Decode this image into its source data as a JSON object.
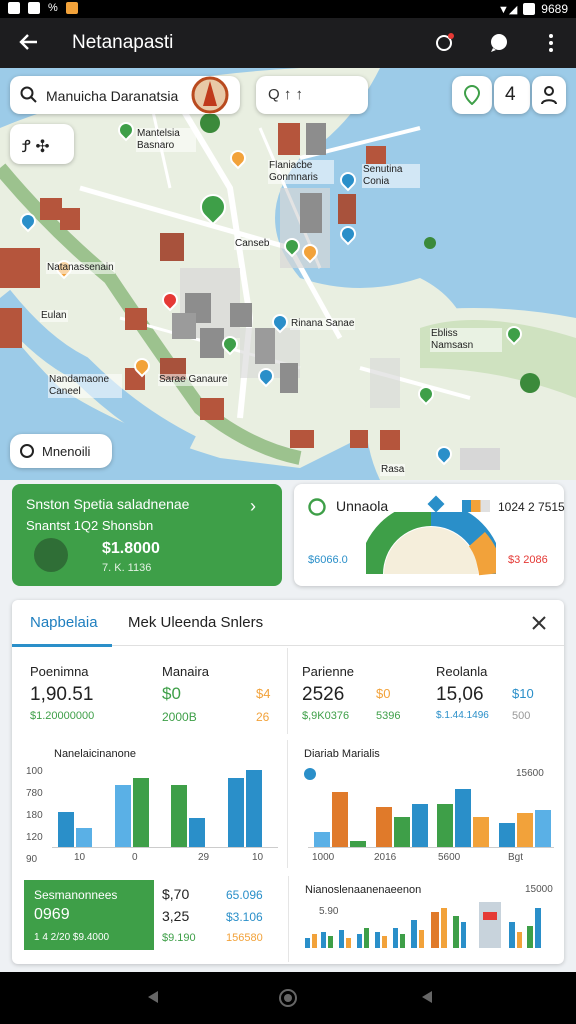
{
  "status": {
    "left_icons": [
      "notification-icon",
      "sim-icon",
      "percent-icon",
      "app-icon"
    ],
    "time": "9689"
  },
  "appbar": {
    "title": "Netanapasti"
  },
  "map": {
    "search_text": "Manuicha Daranatsia",
    "search2_text": "Q ↑ ↑",
    "tool_text": "Ꝭ ✣",
    "zoom_text": "4",
    "labels": [
      "Mantelsia Basnaro",
      "Flaniacbe Gonmnaris",
      "Natanassenain",
      "Eulan",
      "Nandamaone Caneel",
      "Sarae Ganaure",
      "Rinana Sanae",
      "Senutina Conia",
      "Canseb",
      "Ebliss Namsasn",
      "Rasa"
    ],
    "chip_text": "Mnenoili"
  },
  "card_left": {
    "title": "Snston Spetia saladnenae",
    "sub": "Snantst 1Q2 Shonsbn",
    "value": "$1.8000",
    "sub2": "7. K. 1136",
    "color": "#3e9f48"
  },
  "card_right": {
    "title": "Unnaola",
    "value1": "1024 2 7515",
    "left_val": "$6066.0",
    "right_val": "$3 2086"
  },
  "panel": {
    "tab_active": "Napbelaia",
    "tab_title": "Mek Uleenda Snlers",
    "stats": [
      {
        "label": "Poenimna",
        "value": "1,90.51",
        "sub": "$1.20000000",
        "accent": "",
        "accent_sub": ""
      },
      {
        "label": "Manaira",
        "value": "$0",
        "sub": "2000B",
        "accent": "$4",
        "accent_sub": "26"
      },
      {
        "label": "Parienne",
        "value": "2526",
        "sub": "$,9K0376",
        "accent": "$0",
        "accent_sub": "5396"
      },
      {
        "label": "Reolanla",
        "value": "15,06",
        "sub": "$.1.44.1496",
        "accent": "$10",
        "accent_sub": "500"
      }
    ],
    "chart1": {
      "title": "Nanelaicinanone",
      "yticks": [
        "100",
        "780",
        "180",
        "120",
        "90"
      ],
      "xticks": [
        "10",
        "0",
        "29",
        "10"
      ]
    },
    "chart2": {
      "title": "Diariab Marialis",
      "right_label": "15600",
      "xticks": [
        "1000",
        "2016",
        "5600",
        "Bgt"
      ]
    },
    "greenbox": {
      "title": "Sesmanonnees",
      "value": "0969",
      "sub": "1 4 2/20 $9.4000"
    },
    "mini": [
      {
        "a": "$,70",
        "b": "65.096"
      },
      {
        "a": "3,25",
        "b": "$3.106"
      },
      {
        "a": "$9.190",
        "b": "156580"
      }
    ],
    "chart3": {
      "title": "Nianoslenaanenaeenon",
      "value": "5.90",
      "right_val": "15000"
    }
  },
  "chart_data": [
    {
      "type": "bar",
      "title": "Nanelaicinanone",
      "categories": [
        "10",
        "0",
        "29",
        "10"
      ],
      "series": [
        {
          "values": [
            45,
            80,
            80,
            90
          ]
        },
        {
          "values": [
            25,
            90,
            38,
            100
          ]
        }
      ],
      "ylim": [
        0,
        100
      ]
    },
    {
      "type": "bar",
      "title": "Diariab Marialis",
      "categories": [
        "1000",
        "2016",
        "5600",
        "Bgt"
      ],
      "series": [
        {
          "values": [
            25,
            65,
            70,
            40
          ]
        },
        {
          "values": [
            90,
            50,
            95,
            55
          ]
        },
        {
          "values": [
            10,
            70,
            50,
            60
          ]
        }
      ],
      "ylim": [
        0,
        100
      ]
    }
  ]
}
